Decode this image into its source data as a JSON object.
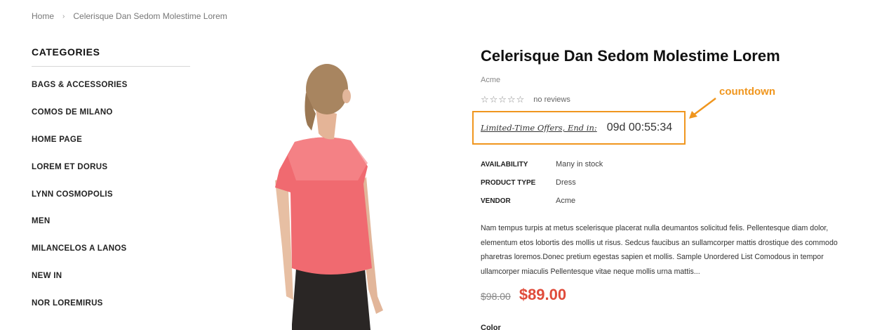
{
  "breadcrumb": {
    "home": "Home",
    "separator": "›",
    "current": "Celerisque Dan Sedom Molestime Lorem"
  },
  "sidebar": {
    "title": "CATEGORIES",
    "items": [
      {
        "label": "BAGS & ACCESSORIES"
      },
      {
        "label": "COMOS DE MILANO"
      },
      {
        "label": "HOME PAGE"
      },
      {
        "label": "LOREM ET DORUS"
      },
      {
        "label": "LYNN COSMOPOLIS"
      },
      {
        "label": "MEN"
      },
      {
        "label": "MILANCELOS A LANOS"
      },
      {
        "label": "NEW IN"
      },
      {
        "label": "NOR LOREMIRUS"
      }
    ]
  },
  "product": {
    "title": "Celerisque Dan Sedom Molestime Lorem",
    "vendor_top": "Acme",
    "stars": "☆☆☆☆☆",
    "reviews": "no reviews",
    "countdown_label": "Limited-Time Offers, End in:",
    "countdown_timer": "09d 00:55:34",
    "specs": [
      {
        "key": "AVAILABILITY",
        "value": "Many in stock"
      },
      {
        "key": "PRODUCT TYPE",
        "value": "Dress"
      },
      {
        "key": "VENDOR",
        "value": "Acme"
      }
    ],
    "description": "Nam tempus turpis at metus scelerisque placerat nulla deumantos solicitud felis. Pellentesque diam dolor, elementum etos lobortis des mollis ut risus. Sedcus faucibus an sullamcorper mattis drostique des commodo pharetras loremos.Donec pretium egestas sapien et mollis. Sample Unordered List Comodous in tempor ullamcorper miaculis Pellentesque vitae neque mollis urna mattis...",
    "old_price": "$98.00",
    "new_price": "$89.00",
    "color_label": "Color"
  },
  "annotation": {
    "label": "countdown",
    "color": "#f0961e"
  },
  "colors": {
    "accent": "#f0961e",
    "sale_price": "#e04b3a",
    "shirt": "#f06a70"
  }
}
